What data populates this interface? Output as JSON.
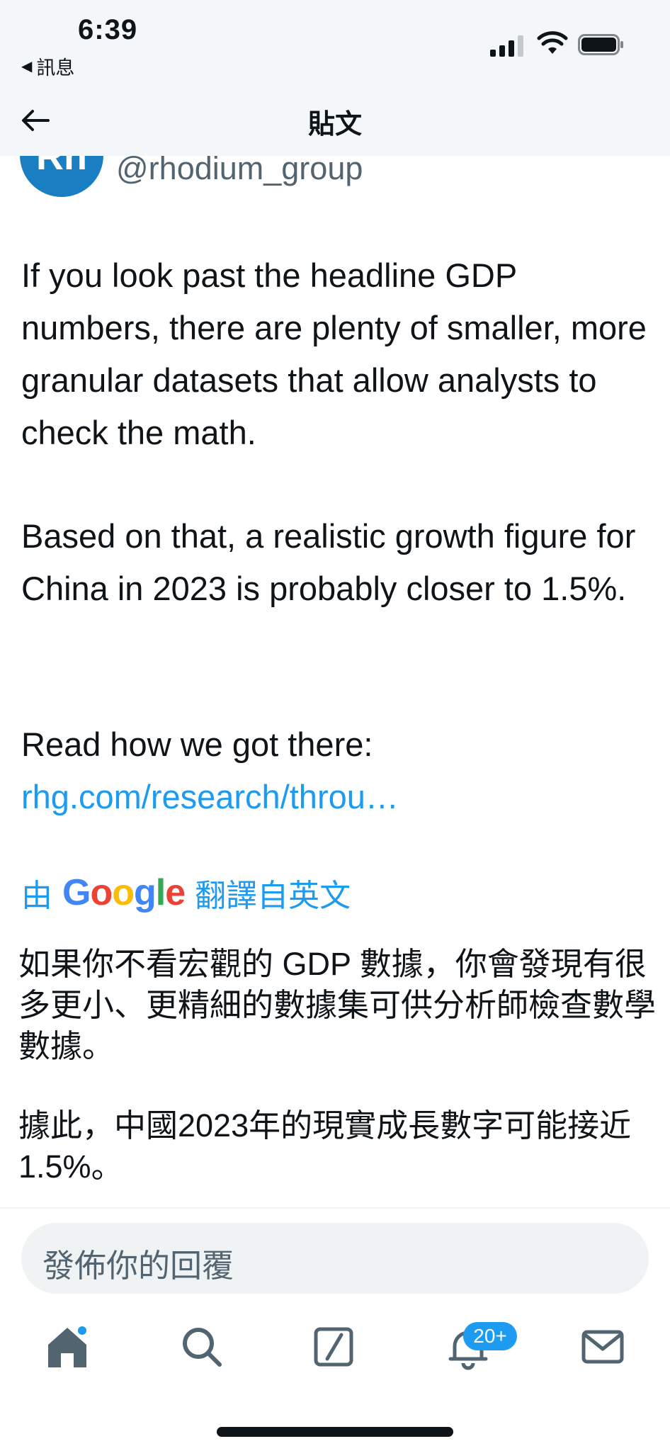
{
  "status_bar": {
    "time": "6:39",
    "back_app_label": "訊息"
  },
  "header": {
    "title": "貼文"
  },
  "author": {
    "avatar_text": "Rh",
    "handle": "@rhodium_group"
  },
  "tweet": {
    "paragraph_1": "If you look past the headline GDP numbers, there are plenty of smaller, more granular datasets that allow analysts to check the math.",
    "paragraph_2": "Based on that, a realistic growth figure for China in 2023 is probably closer to 1.5%.",
    "paragraph_3_prefix": "Read how we got there: ",
    "link_text": "rhg.com/research/throu…"
  },
  "translation": {
    "prefix": "由",
    "google_logo_text": "Google",
    "suffix": "翻譯自英文",
    "paragraph_1": "如果你不看宏觀的 GDP 數據，你會發現有很多更小、更精細的數據集可供分析師檢查數學數據。",
    "paragraph_2": "據此，中國2023年的現實成長數字可能接近1.5%。"
  },
  "reply": {
    "placeholder": "發佈你的回覆"
  },
  "tabs": {
    "notifications_badge": "20+",
    "icons": [
      "home-icon",
      "search-icon",
      "compose-icon",
      "bell-icon",
      "mail-icon"
    ]
  },
  "colors": {
    "link": "#1d9bf0",
    "avatar": "#1a7ec2",
    "header_bg": "#f4f7fa",
    "secondary_text": "#536471"
  }
}
